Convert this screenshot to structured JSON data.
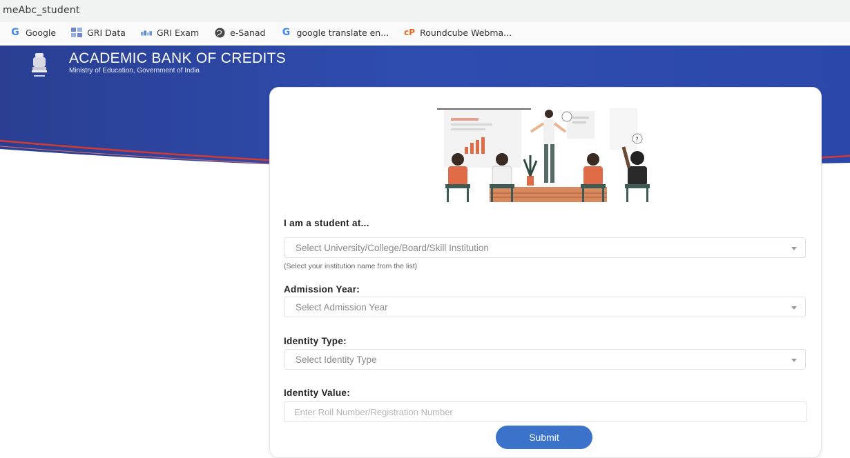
{
  "browser": {
    "url_text": "meAbc_student",
    "bookmarks": [
      {
        "label": "Google",
        "icon": "google-icon"
      },
      {
        "label": "GRI Data",
        "icon": "grid-icon"
      },
      {
        "label": "GRI Exam",
        "icon": "grid-icon"
      },
      {
        "label": "e-Sanad",
        "icon": "globe-icon"
      },
      {
        "label": "google translate en...",
        "icon": "google-icon"
      },
      {
        "label": "Roundcube Webma...",
        "icon": "roundcube-icon"
      }
    ]
  },
  "header": {
    "title": "ACADEMIC BANK OF CREDITS",
    "subtitle": "Ministry of Education, Government of India",
    "colors": {
      "band": "#2c4aa6",
      "stripe": "#d63a2f"
    }
  },
  "form": {
    "institution_label": "I am a student at...",
    "institution_placeholder": "Select University/College/Board/Skill Institution",
    "institution_hint": "(Select your institution name from the list)",
    "admission_label": "Admission Year:",
    "admission_placeholder": "Select Admission Year",
    "identity_type_label": "Identity Type:",
    "identity_type_placeholder": "Select Identity Type",
    "identity_value_label": "Identity Value:",
    "identity_value_placeholder": "Enter Roll Number/Registration Number",
    "submit_label": "Submit",
    "accent": "#3a73c9"
  }
}
